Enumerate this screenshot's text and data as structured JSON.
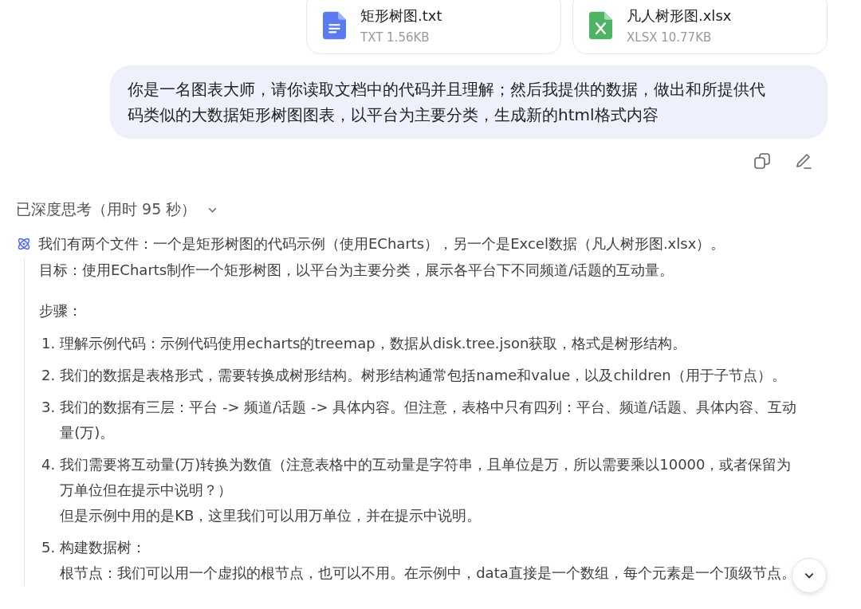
{
  "attachments": [
    {
      "kind": "txt",
      "name": "矩形树图.txt",
      "meta": "TXT 1.56KB"
    },
    {
      "kind": "xlsx",
      "name": "凡人树形图.xlsx",
      "meta": "XLSX 10.77KB"
    }
  ],
  "user_message": "你是一名图表大师，请你读取文档中的代码并且理解；然后我提供的数据，做出和所提供代码类似的大数据矩形树图图表，以平台为主要分类，生成新的html格式内容",
  "thinking": {
    "title": "已深度思考（用时 95 秒）",
    "expanded": true,
    "intro": "我们有两个文件：一个是矩形树图的代码示例（使用ECharts），另一个是Excel数据（凡人树形图.xlsx）。",
    "goal": "目标：使用ECharts制作一个矩形树图，以平台为主要分类，展示各平台下不同频道/话题的互动量。",
    "steps_label": "步骤：",
    "steps": [
      {
        "number": "1.",
        "text": "理解示例代码：示例代码使用echarts的treemap，数据从disk.tree.json获取，格式是树形结构。"
      },
      {
        "number": "2.",
        "text": "我们的数据是表格形式，需要转换成树形结构。树形结构通常包括name和value，以及children（用于子节点）。"
      },
      {
        "number": "3.",
        "text": "我们的数据有三层：平台 -> 频道/话题 -> 具体内容。但注意，表格中只有四列：平台、频道/话题、具体内容、互动量(万)。"
      },
      {
        "number": "4.",
        "text": "我们需要将互动量(万)转换为数值（注意表格中的互动量是字符串，且单位是万，所以需要乘以10000，或者保留为万单位但在提示中说明？）",
        "note": "但是示例中用的是KB，这里我们可以用万单位，并在提示中说明。"
      },
      {
        "number": "5.",
        "text": "构建数据树：",
        "note": "根节点：我们可以用一个虚拟的根节点，也可以不用。在示例中，data直接是一个数组，每个元素是一个顶级节点。"
      }
    ]
  }
}
